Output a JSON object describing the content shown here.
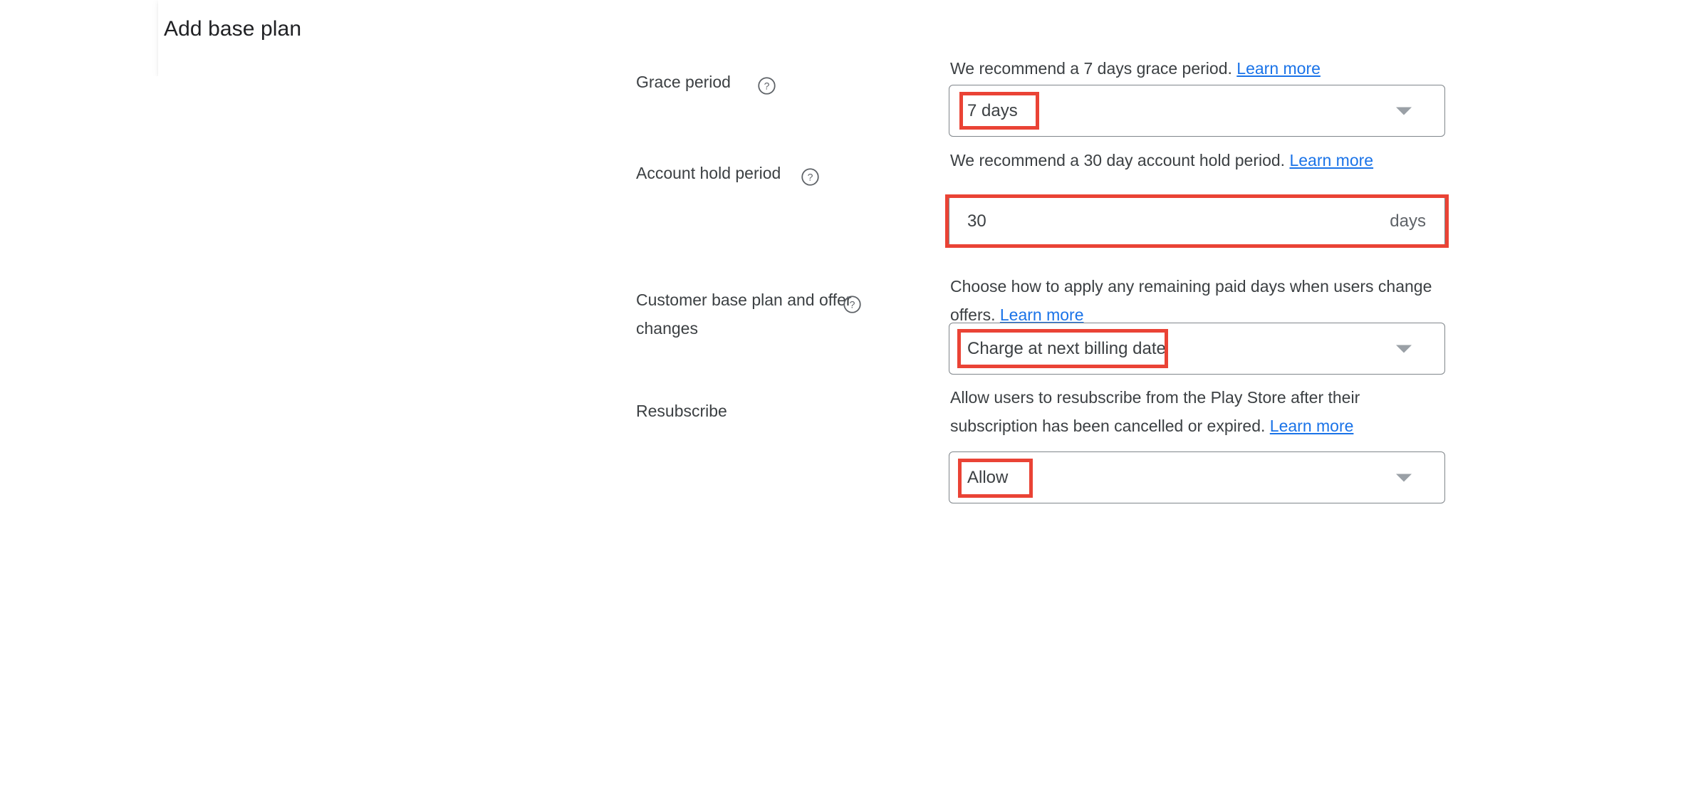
{
  "header": {
    "title": "Add base plan"
  },
  "icons": {
    "help": "help-circle-icon",
    "dropdown": "chevron-down-icon"
  },
  "colors": {
    "link": "#1a73e8",
    "annotation": "#ee4b2b",
    "text": "#3c4043",
    "field_border": "#80868b"
  },
  "form": {
    "rows": [
      {
        "id": "grace-period",
        "label": "Grace period",
        "has_help_icon": true,
        "description_prefix": "We recommend a 7 days grace period.",
        "learn_more": "Learn more",
        "control_type": "select",
        "value": "7 days",
        "suffix": "",
        "highlight": "value"
      },
      {
        "id": "account-hold-period",
        "label": "Account hold period",
        "has_help_icon": true,
        "description_prefix": "We recommend a 30 day account hold period.",
        "learn_more": "Learn more",
        "control_type": "text",
        "value": "30",
        "suffix": "days",
        "highlight": "full"
      },
      {
        "id": "customer-base-plan-and-offer-changes",
        "label": "Customer base plan and offer changes",
        "has_help_icon": true,
        "description_prefix": "Choose how to apply any remaining paid days when users change offers.",
        "learn_more": "Learn more",
        "control_type": "select",
        "value": "Charge at next billing date",
        "suffix": "",
        "highlight": "value"
      },
      {
        "id": "resubscribe",
        "label": "Resubscribe",
        "has_help_icon": false,
        "description_prefix": "Allow users to resubscribe from the Play Store after their subscription has been cancelled or expired.",
        "learn_more": "Learn more",
        "control_type": "select",
        "value": "Allow",
        "suffix": "",
        "highlight": "value"
      }
    ]
  }
}
